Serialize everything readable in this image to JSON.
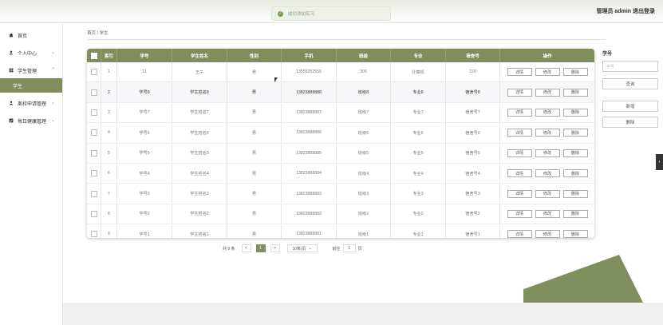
{
  "header": {
    "user_text": "管理员 admin  退出登录",
    "toast_text": "成功添加实习"
  },
  "sidebar": {
    "items": [
      {
        "label": "首页",
        "icon": "home-icon",
        "has_arrow": false
      },
      {
        "label": "个人中心",
        "icon": "person-icon",
        "has_arrow": true
      },
      {
        "label": "学生管理",
        "icon": "grid-icon",
        "has_arrow": true
      },
      {
        "label": "学生",
        "icon": "",
        "has_arrow": false,
        "active": true
      },
      {
        "label": "离校申请管理",
        "icon": "person-icon",
        "has_arrow": true
      },
      {
        "label": "每日健康管理",
        "icon": "check-square-icon",
        "has_arrow": true
      }
    ]
  },
  "breadcrumb": {
    "home": "首页",
    "sep": "/",
    "current": "学生"
  },
  "table": {
    "headers": [
      "",
      "索引",
      "学号",
      "学生姓名",
      "性别",
      "手机",
      "班级",
      "专业",
      "宿舍号",
      "操作"
    ],
    "rows": [
      {
        "idx": "1",
        "xh": "11",
        "name": "王子",
        "sex": "男",
        "phone": "13555252555",
        "cls": "305",
        "major": "计算机",
        "dorm": "220"
      },
      {
        "idx": "2",
        "xh": "学号8",
        "name": "学生姓名8",
        "sex": "男",
        "phone": "13823888888",
        "cls": "班级8",
        "major": "专业8",
        "dorm": "宿舍号8"
      },
      {
        "idx": "3",
        "xh": "学号7",
        "name": "学生姓名7",
        "sex": "男",
        "phone": "13823888887",
        "cls": "班级7",
        "major": "专业7",
        "dorm": "宿舍号7"
      },
      {
        "idx": "4",
        "xh": "学号6",
        "name": "学生姓名6",
        "sex": "男",
        "phone": "13823888886",
        "cls": "班级6",
        "major": "专业6",
        "dorm": "宿舍号6"
      },
      {
        "idx": "5",
        "xh": "学号5",
        "name": "学生姓名5",
        "sex": "男",
        "phone": "13823888885",
        "cls": "班级5",
        "major": "专业5",
        "dorm": "宿舍号5"
      },
      {
        "idx": "6",
        "xh": "学号4",
        "name": "学生姓名4",
        "sex": "男",
        "phone": "13823888884",
        "cls": "班级4",
        "major": "专业4",
        "dorm": "宿舍号4"
      },
      {
        "idx": "7",
        "xh": "学号3",
        "name": "学生姓名3",
        "sex": "男",
        "phone": "13823888883",
        "cls": "班级3",
        "major": "专业3",
        "dorm": "宿舍号3"
      },
      {
        "idx": "8",
        "xh": "学号2",
        "name": "学生姓名2",
        "sex": "男",
        "phone": "13823888882",
        "cls": "班级2",
        "major": "专业2",
        "dorm": "宿舍号2"
      },
      {
        "idx": "9",
        "xh": "学号1",
        "name": "学生姓名1",
        "sex": "男",
        "phone": "13823888881",
        "cls": "班级1",
        "major": "专业1",
        "dorm": "宿舍号1"
      }
    ],
    "actions": [
      "详情",
      "修改",
      "删除"
    ]
  },
  "pagination": {
    "total": "共 9 条",
    "prev": "<",
    "current_page": "1",
    "next": ">",
    "page_size": "10条/页",
    "goto_label": "前往",
    "goto_value": "1",
    "goto_suffix": "页"
  },
  "search_panel": {
    "label": "学号",
    "placeholder": "学号",
    "search_button": "查询",
    "add_button": "新增",
    "delete_button": "删除"
  },
  "colors": {
    "accent": "#7f8e5c"
  }
}
